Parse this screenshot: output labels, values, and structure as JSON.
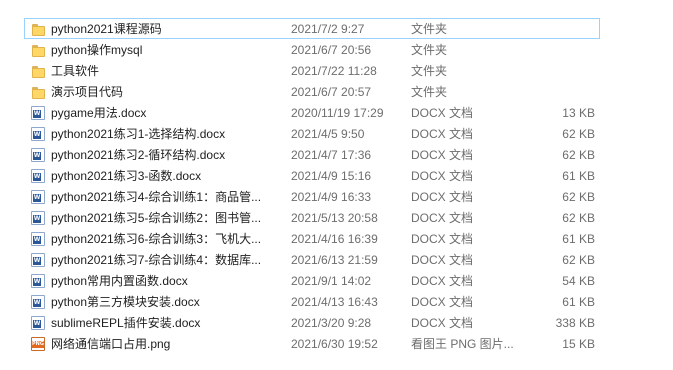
{
  "files": [
    {
      "name": "python2021课程源码",
      "date": "2021/7/2 9:27",
      "type": "文件夹",
      "size": "",
      "icon": "folder-icon",
      "selected": true
    },
    {
      "name": "python操作mysql",
      "date": "2021/6/7 20:56",
      "type": "文件夹",
      "size": "",
      "icon": "folder-icon"
    },
    {
      "name": "工具软件",
      "date": "2021/7/22 11:28",
      "type": "文件夹",
      "size": "",
      "icon": "folder-icon"
    },
    {
      "name": "演示项目代码",
      "date": "2021/6/7 20:57",
      "type": "文件夹",
      "size": "",
      "icon": "folder-icon"
    },
    {
      "name": "pygame用法.docx",
      "date": "2020/11/19 17:29",
      "type": "DOCX 文档",
      "size": "13 KB",
      "icon": "docx-icon"
    },
    {
      "name": "python2021练习1-选择结构.docx",
      "date": "2021/4/5 9:50",
      "type": "DOCX 文档",
      "size": "62 KB",
      "icon": "docx-icon"
    },
    {
      "name": "python2021练习2-循环结构.docx",
      "date": "2021/4/7 17:36",
      "type": "DOCX 文档",
      "size": "62 KB",
      "icon": "docx-icon"
    },
    {
      "name": "python2021练习3-函数.docx",
      "date": "2021/4/9 15:16",
      "type": "DOCX 文档",
      "size": "61 KB",
      "icon": "docx-icon"
    },
    {
      "name": "python2021练习4-综合训练1：商品管...",
      "date": "2021/4/9 16:33",
      "type": "DOCX 文档",
      "size": "62 KB",
      "icon": "docx-icon"
    },
    {
      "name": "python2021练习5-综合训练2：图书管...",
      "date": "2021/5/13 20:58",
      "type": "DOCX 文档",
      "size": "62 KB",
      "icon": "docx-icon"
    },
    {
      "name": "python2021练习6-综合训练3：飞机大...",
      "date": "2021/4/16 16:39",
      "type": "DOCX 文档",
      "size": "61 KB",
      "icon": "docx-icon"
    },
    {
      "name": "python2021练习7-综合训练4：数据库...",
      "date": "2021/6/13 21:59",
      "type": "DOCX 文档",
      "size": "62 KB",
      "icon": "docx-icon"
    },
    {
      "name": "python常用内置函数.docx",
      "date": "2021/9/1 14:02",
      "type": "DOCX 文档",
      "size": "54 KB",
      "icon": "docx-icon"
    },
    {
      "name": "python第三方模块安装.docx",
      "date": "2021/4/13 16:43",
      "type": "DOCX 文档",
      "size": "61 KB",
      "icon": "docx-icon"
    },
    {
      "name": "sublimeREPL插件安装.docx",
      "date": "2021/3/20 9:28",
      "type": "DOCX 文档",
      "size": "338 KB",
      "icon": "docx-icon"
    },
    {
      "name": "网络通信端口占用.png",
      "date": "2021/6/30 19:52",
      "type": "看图王 PNG 图片...",
      "size": "15 KB",
      "icon": "png-icon"
    }
  ]
}
